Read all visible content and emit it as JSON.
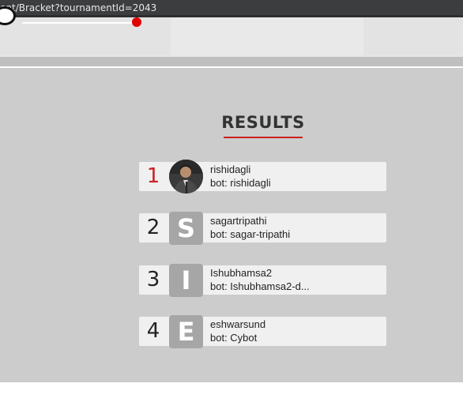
{
  "browser": {
    "url": "ent/Bracket?tournamentId=2043"
  },
  "colors": {
    "accent": "#cc1f1f",
    "content_bg": "#cccccc",
    "row_bg": "#f0f0f0",
    "letter_avatar_bg": "#a6a6a6"
  },
  "results": {
    "title": "RESULTS",
    "entries": [
      {
        "rank": "1",
        "name": "rishidagli",
        "bot": "bot: rishidagli",
        "avatar": "photo"
      },
      {
        "rank": "2",
        "name": "sagartripathi",
        "bot": "bot: sagar-tripathi",
        "avatar_letter": "S"
      },
      {
        "rank": "3",
        "name": "Ishubhamsa2",
        "bot": "bot: Ishubhamsa2-d...",
        "avatar_letter": "I"
      },
      {
        "rank": "4",
        "name": "eshwarsund",
        "bot": "bot: Cybot",
        "avatar_letter": "E"
      }
    ]
  }
}
